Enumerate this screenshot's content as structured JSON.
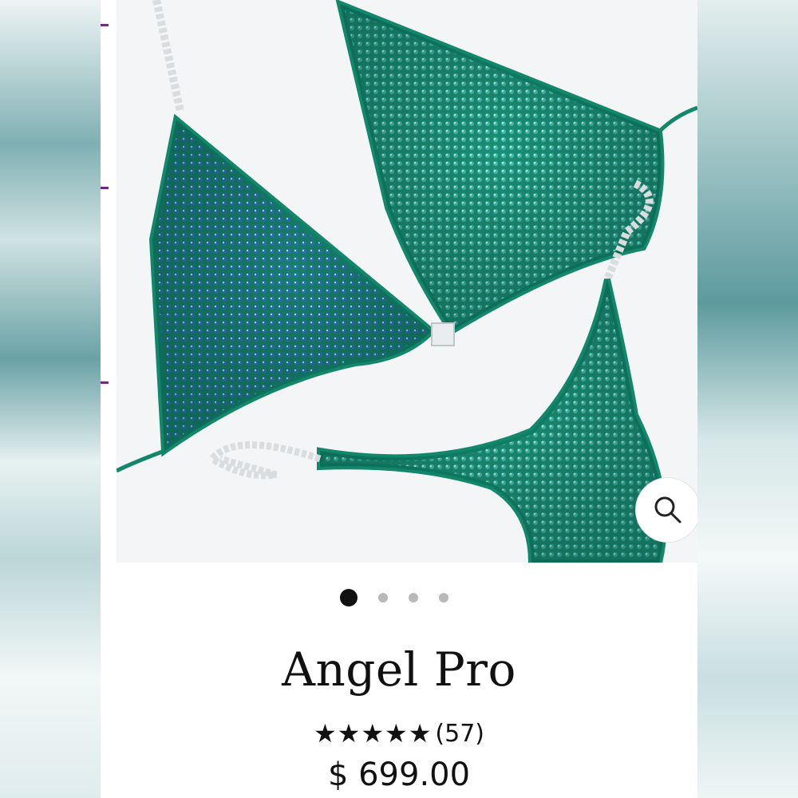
{
  "product": {
    "name": "Angel Pro",
    "rating_stars": "★★★★★",
    "rating_value": 5,
    "review_count": "(57)",
    "price": "$ 699.00"
  },
  "gallery": {
    "image_count": 4,
    "active_index": 0
  },
  "colors": {
    "fabric": "#1f9c80",
    "accent_purple": "#6d2a8a"
  },
  "icons": {
    "zoom": "magnifier-icon"
  }
}
